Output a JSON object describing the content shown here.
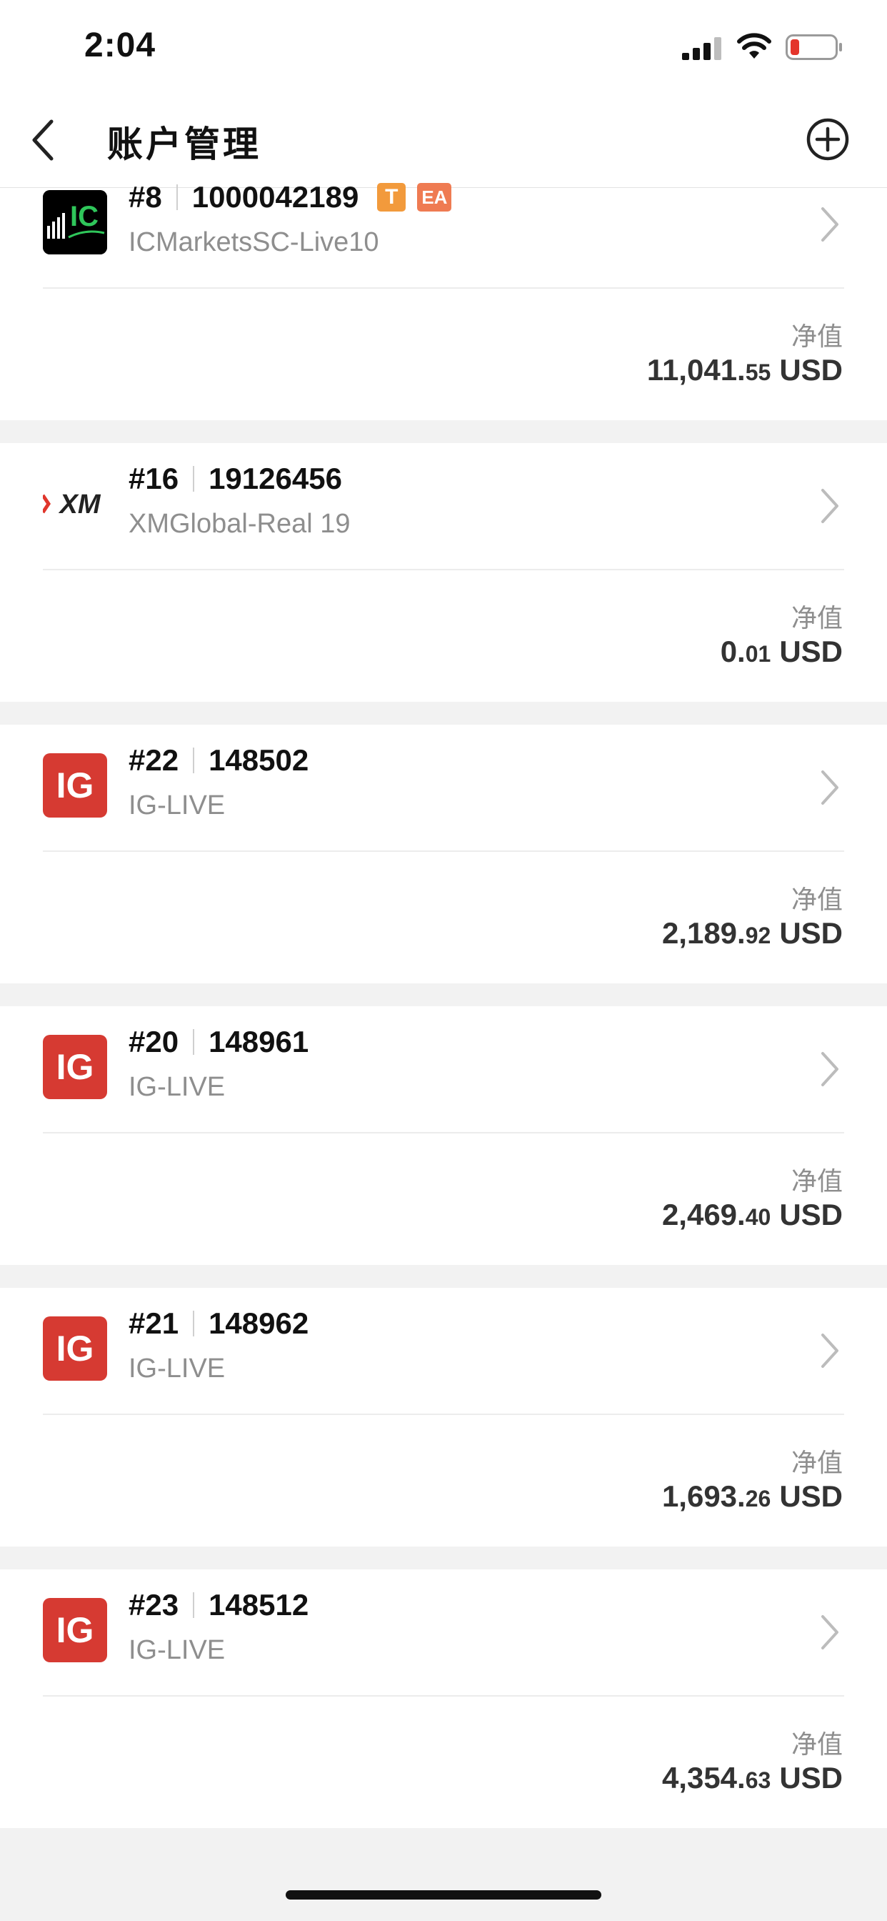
{
  "status_bar": {
    "time": "2:04"
  },
  "nav": {
    "title": "账户管理"
  },
  "accounts": [
    {
      "index": "#8",
      "number": "1000042189",
      "server": "ICMarketsSC-Live10",
      "logo": "IC",
      "badges": [
        "T",
        "EA"
      ],
      "equity_label": "净值",
      "equity_int": "11,041.",
      "equity_dec": "55",
      "currency": "USD"
    },
    {
      "index": "#16",
      "number": "19126456",
      "server": "XMGlobal-Real 19",
      "logo": "XM",
      "equity_label": "净值",
      "equity_int": "0.",
      "equity_dec": "01",
      "currency": "USD"
    },
    {
      "index": "#22",
      "number": "148502",
      "server": "IG-LIVE",
      "logo": "IG",
      "equity_label": "净值",
      "equity_int": "2,189.",
      "equity_dec": "92",
      "currency": "USD"
    },
    {
      "index": "#20",
      "number": "148961",
      "server": "IG-LIVE",
      "logo": "IG",
      "equity_label": "净值",
      "equity_int": "2,469.",
      "equity_dec": "40",
      "currency": "USD"
    },
    {
      "index": "#21",
      "number": "148962",
      "server": "IG-LIVE",
      "logo": "IG",
      "equity_label": "净值",
      "equity_int": "1,693.",
      "equity_dec": "26",
      "currency": "USD"
    },
    {
      "index": "#23",
      "number": "148512",
      "server": "IG-LIVE",
      "logo": "IG",
      "equity_label": "净值",
      "equity_int": "4,354.",
      "equity_dec": "63",
      "currency": "USD"
    }
  ],
  "colors": {
    "ig_red": "#d63a32",
    "badge_t": "#f29a3c",
    "badge_ea": "#ef7b52",
    "ic_green": "#2fc65a",
    "xm_red": "#e0362c"
  },
  "icons": {
    "back": "chevron-left-icon",
    "add": "plus-circle-icon",
    "row": "chevron-right-icon"
  }
}
